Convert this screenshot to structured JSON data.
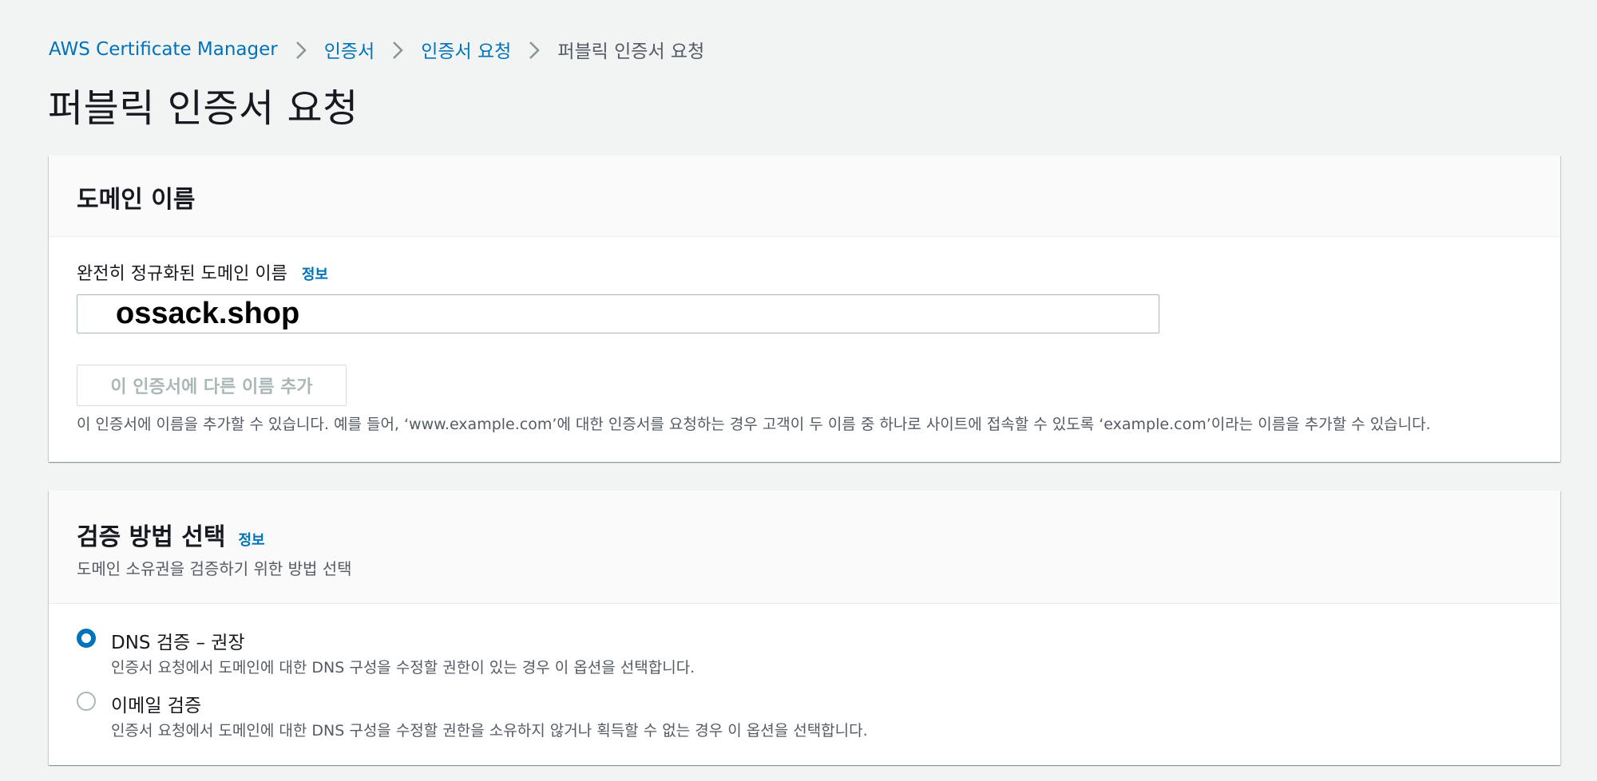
{
  "breadcrumb": {
    "items": [
      "AWS Certificate Manager",
      "인증서",
      "인증서 요청"
    ],
    "current": "퍼블릭 인증서 요청"
  },
  "page_title": "퍼블릭 인증서 요청",
  "domain_panel": {
    "title": "도메인 이름",
    "field_label": "완전히 정규화된 도메인 이름",
    "info_label": "정보",
    "input_value": "ossack.shop",
    "add_name_button": "이 인증서에 다른 이름 추가",
    "description": "이 인증서에 이름을 추가할 수 있습니다. 예를 들어, ‘www.example.com’에 대한 인증서를 요청하는 경우 고객이 두 이름 중 하나로 사이트에 접속할 수 있도록 ‘example.com’이라는 이름을 추가할 수 있습니다."
  },
  "validation_panel": {
    "title": "검증 방법 선택",
    "info_label": "정보",
    "description": "도메인 소유권을 검증하기 위한 방법 선택",
    "options": [
      {
        "label": "DNS 검증 – 권장",
        "description": "인증서 요청에서 도메인에 대한 DNS 구성을 수정할 권한이 있는 경우 이 옵션을 선택합니다.",
        "selected": true
      },
      {
        "label": "이메일 검증",
        "description": "인증서 요청에서 도메인에 대한 DNS 구성을 수정할 권한을 소유하지 않거나 획득할 수 없는 경우 이 옵션을 선택합니다.",
        "selected": false
      }
    ]
  },
  "colors": {
    "link": "#0073bb",
    "background": "#f2f3f3",
    "text": "#16191f",
    "secondary_text": "#545b64"
  }
}
